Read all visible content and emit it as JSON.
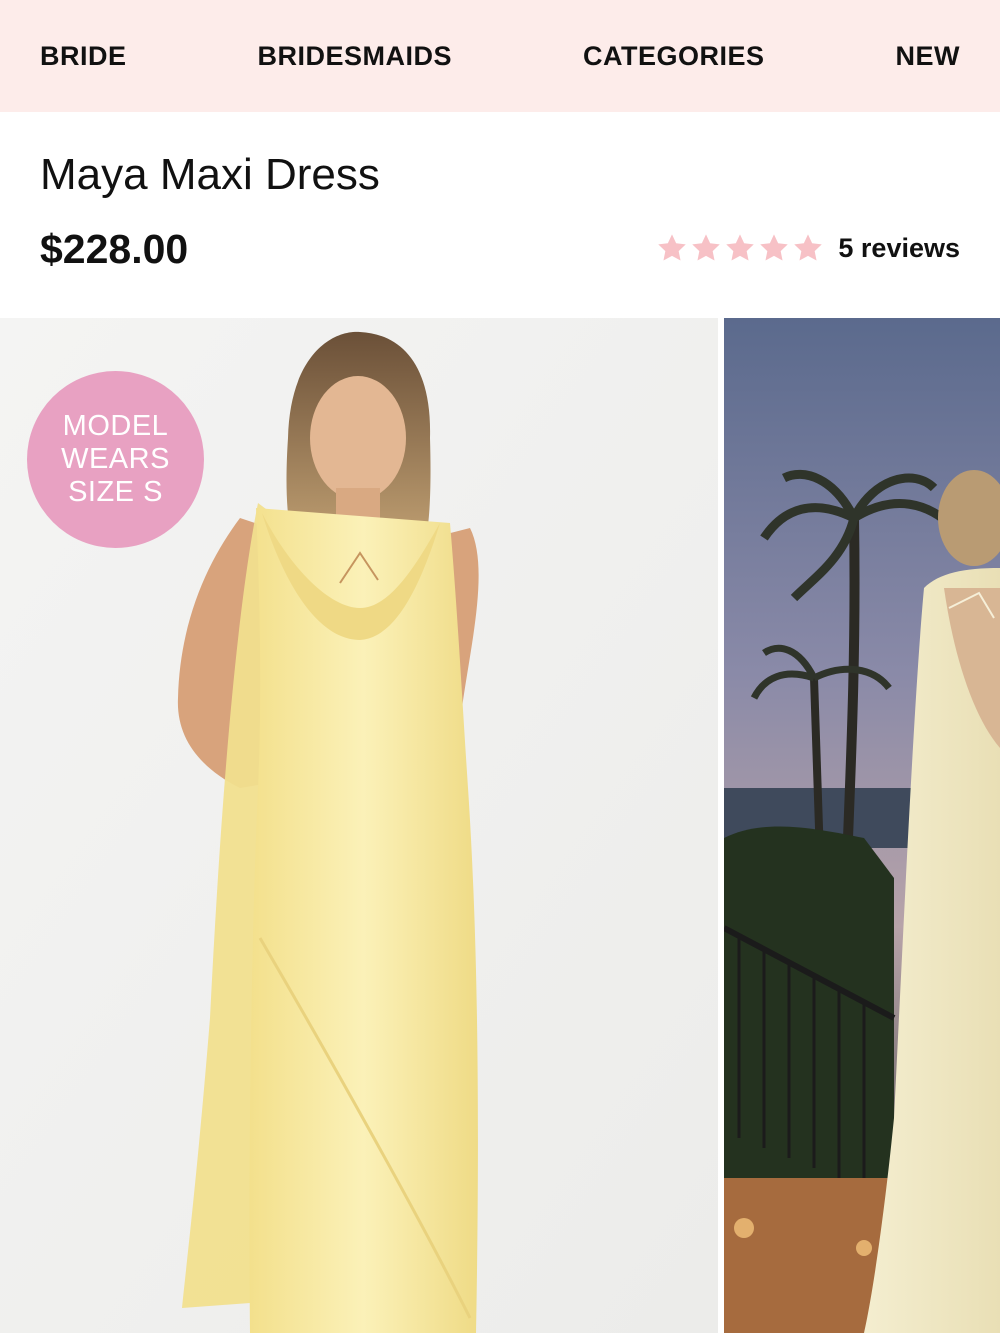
{
  "nav": {
    "items": [
      "BRIDE",
      "BRIDESMAIDS",
      "CATEGORIES",
      "NEW"
    ]
  },
  "product": {
    "title": "Maya Maxi Dress",
    "price": "$228.00",
    "rating": {
      "stars_filled": 5,
      "stars_total": 5,
      "reviews_label": "5 reviews"
    }
  },
  "gallery": {
    "badge_lines": [
      "MODEL",
      "WEARS",
      "SIZE S"
    ]
  },
  "colors": {
    "nav_background": "#fdecea",
    "star": "#f7c1c6",
    "badge": "#e8a1c2",
    "dress": "#f6e89a"
  },
  "icons": [
    "star-icon"
  ]
}
